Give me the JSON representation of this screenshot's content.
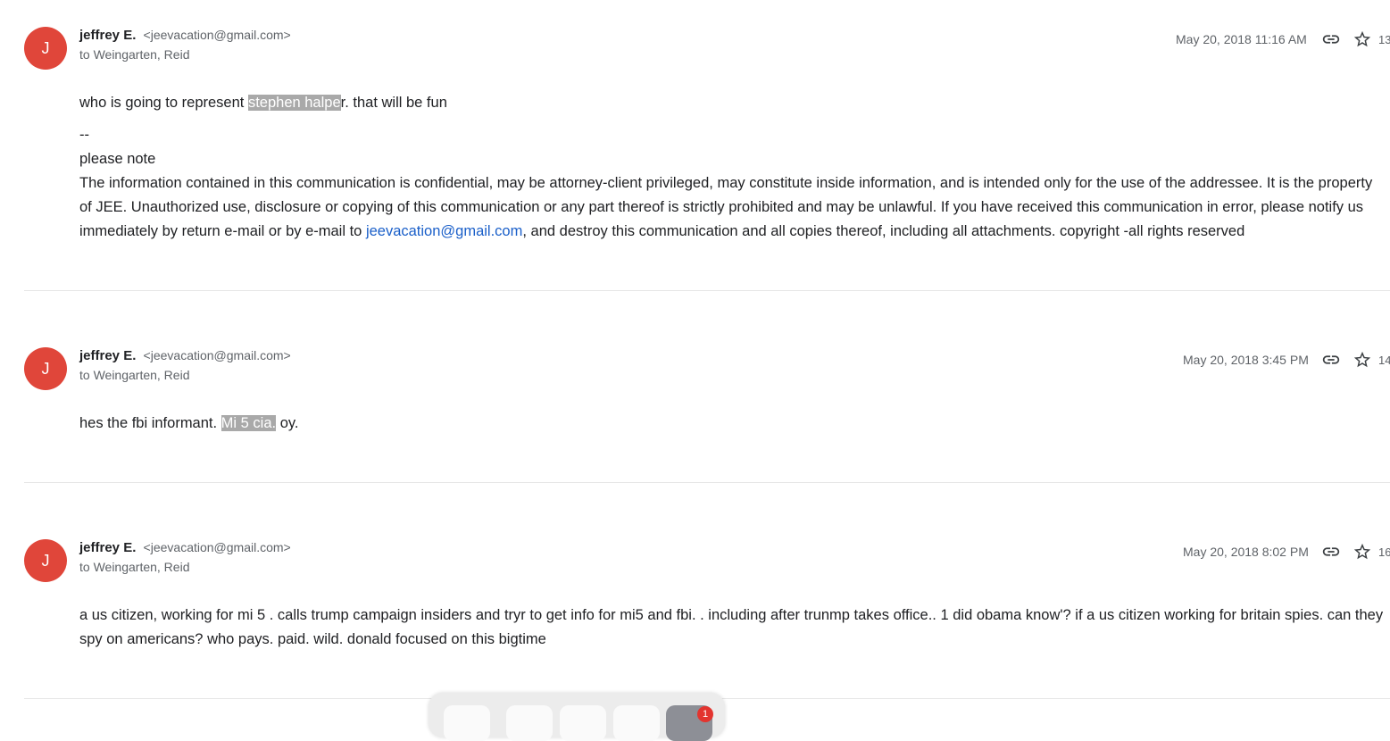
{
  "messages": [
    {
      "avatar": "J",
      "sender_name": "jeffrey E.",
      "sender_email": "<jeevacation@gmail.com>",
      "recipient": "to Weingarten, Reid",
      "date": "May 20, 2018 11:16 AM",
      "count": "13",
      "body_pre": "who is going to represent ",
      "body_highlight": "stephen halpe",
      "body_post": "r. that will be fun",
      "sig_dashes": "--",
      "sig_note": "please note",
      "sig_text_1": "The information contained in this communication is confidential, may be attorney-client privileged, may constitute inside information, and is intended only for the use of the addressee. It is the property of JEE. Unauthorized use, disclosure or copying of this communication or any part thereof is strictly prohibited and may be unlawful. If you have received this communication in error, please notify us immediately by return e-mail or by e-mail to ",
      "sig_link": "jeevacation@gmail.com",
      "sig_text_2": ", and destroy this communication and all copies thereof, including all attachments. copyright -all rights reserved"
    },
    {
      "avatar": "J",
      "sender_name": "jeffrey E.",
      "sender_email": "<jeevacation@gmail.com>",
      "recipient": "to Weingarten, Reid",
      "date": "May 20, 2018 3:45 PM",
      "count": "14",
      "body_pre": "hes the fbi informant. ",
      "body_highlight": "Mi 5 cia.",
      "body_post": " oy."
    },
    {
      "avatar": "J",
      "sender_name": "jeffrey E.",
      "sender_email": "<jeevacation@gmail.com>",
      "recipient": "to Weingarten, Reid",
      "date": "May 20, 2018 8:02 PM",
      "count": "16",
      "body": "a us citizen, working for mi 5 . calls trump campaign insiders and tryr to get info for mi5 and fbi. . including after trunmp takes office.. 1 did obama know'? if a us citizen working for britain spies. can they spy on americans? who pays. paid. wild. donald focused on this bigtime"
    }
  ],
  "dock": {
    "badge": "1"
  },
  "colors": {
    "avatar": "#e0463a",
    "link": "#1a5fc9",
    "highlight": "#a9a9a9",
    "badge": "#e3342f"
  },
  "icons": [
    "link-icon",
    "star-icon"
  ]
}
